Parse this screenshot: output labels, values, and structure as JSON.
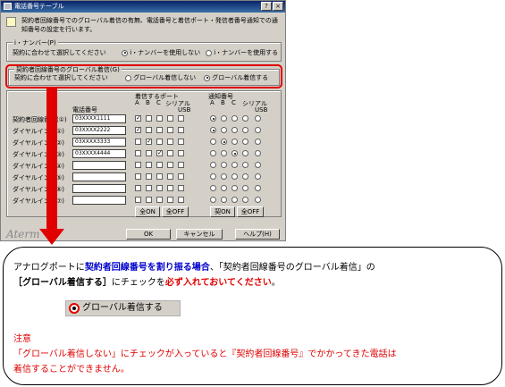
{
  "window": {
    "title": "電話番号テーブル",
    "description_line1": "契約者回線番号でのグローバル着信の有無、電話番号と着信ポート・発信者番号通知での通",
    "description_line2": "知番号の設定を行います。"
  },
  "inumber": {
    "title": "i・ナンバー(P)",
    "text": "契約に合わせて選択してください",
    "option_use": "i・ナンバーを使用しない",
    "option_nouse": "i・ナンバーを使用する"
  },
  "global": {
    "title": "契約者回線番号のグローバル着信(G)",
    "text": "契約に合わせて選択してください",
    "option_no": "グローバル着信しない",
    "option_yes": "グローバル着信する"
  },
  "table": {
    "phone_header": "電話番号",
    "port_header": "着信するポート",
    "notify_header": "通知番号",
    "col_a": "A",
    "col_b": "B",
    "col_c": "C",
    "col_serial": "シリアル",
    "col_usb": "USB",
    "rows": [
      {
        "label": "契約者回線番号(①)",
        "value": "03XXXX1111"
      },
      {
        "label": "ダイヤルイン1(①)",
        "value": "03XXXX2222"
      },
      {
        "label": "ダイヤルイン2(②)",
        "value": "03XXXX3333"
      },
      {
        "label": "ダイヤルイン3(③)",
        "value": "03XXXX4444"
      },
      {
        "label": "ダイヤルイン4(④)",
        "value": ""
      },
      {
        "label": "ダイヤルイン5(⑤)",
        "value": ""
      },
      {
        "label": "ダイヤルイン6(⑥)",
        "value": ""
      },
      {
        "label": "ダイヤルイン7(⑦)",
        "value": ""
      }
    ],
    "all_on": "全ON",
    "all_off": "全OFF",
    "notify_on": "契ON",
    "notify_all_off": "全OFF"
  },
  "buttons": {
    "ok": "OK",
    "cancel": "キャンセル",
    "help": "ヘルプ(H)"
  },
  "logo": "Aterm",
  "callout": {
    "l1_a": "アナログポートに",
    "l1_b": "契約者回線番号を割り振る場合",
    "l1_c": "、「契約者回線番号のグローバル着信」の",
    "l2_a": "［グローバル着信する］",
    "l2_b": "にチェックを",
    "l2_c": "必ず入れておいてください",
    "l2_d": "。",
    "demo_label": "グローバル着信する",
    "note_title": "注意",
    "note_line1": "「グローバル着信しない」にチェックが入っていると『契約者回線番号』でかかってきた電話は",
    "note_line2": "着信することができません。"
  }
}
